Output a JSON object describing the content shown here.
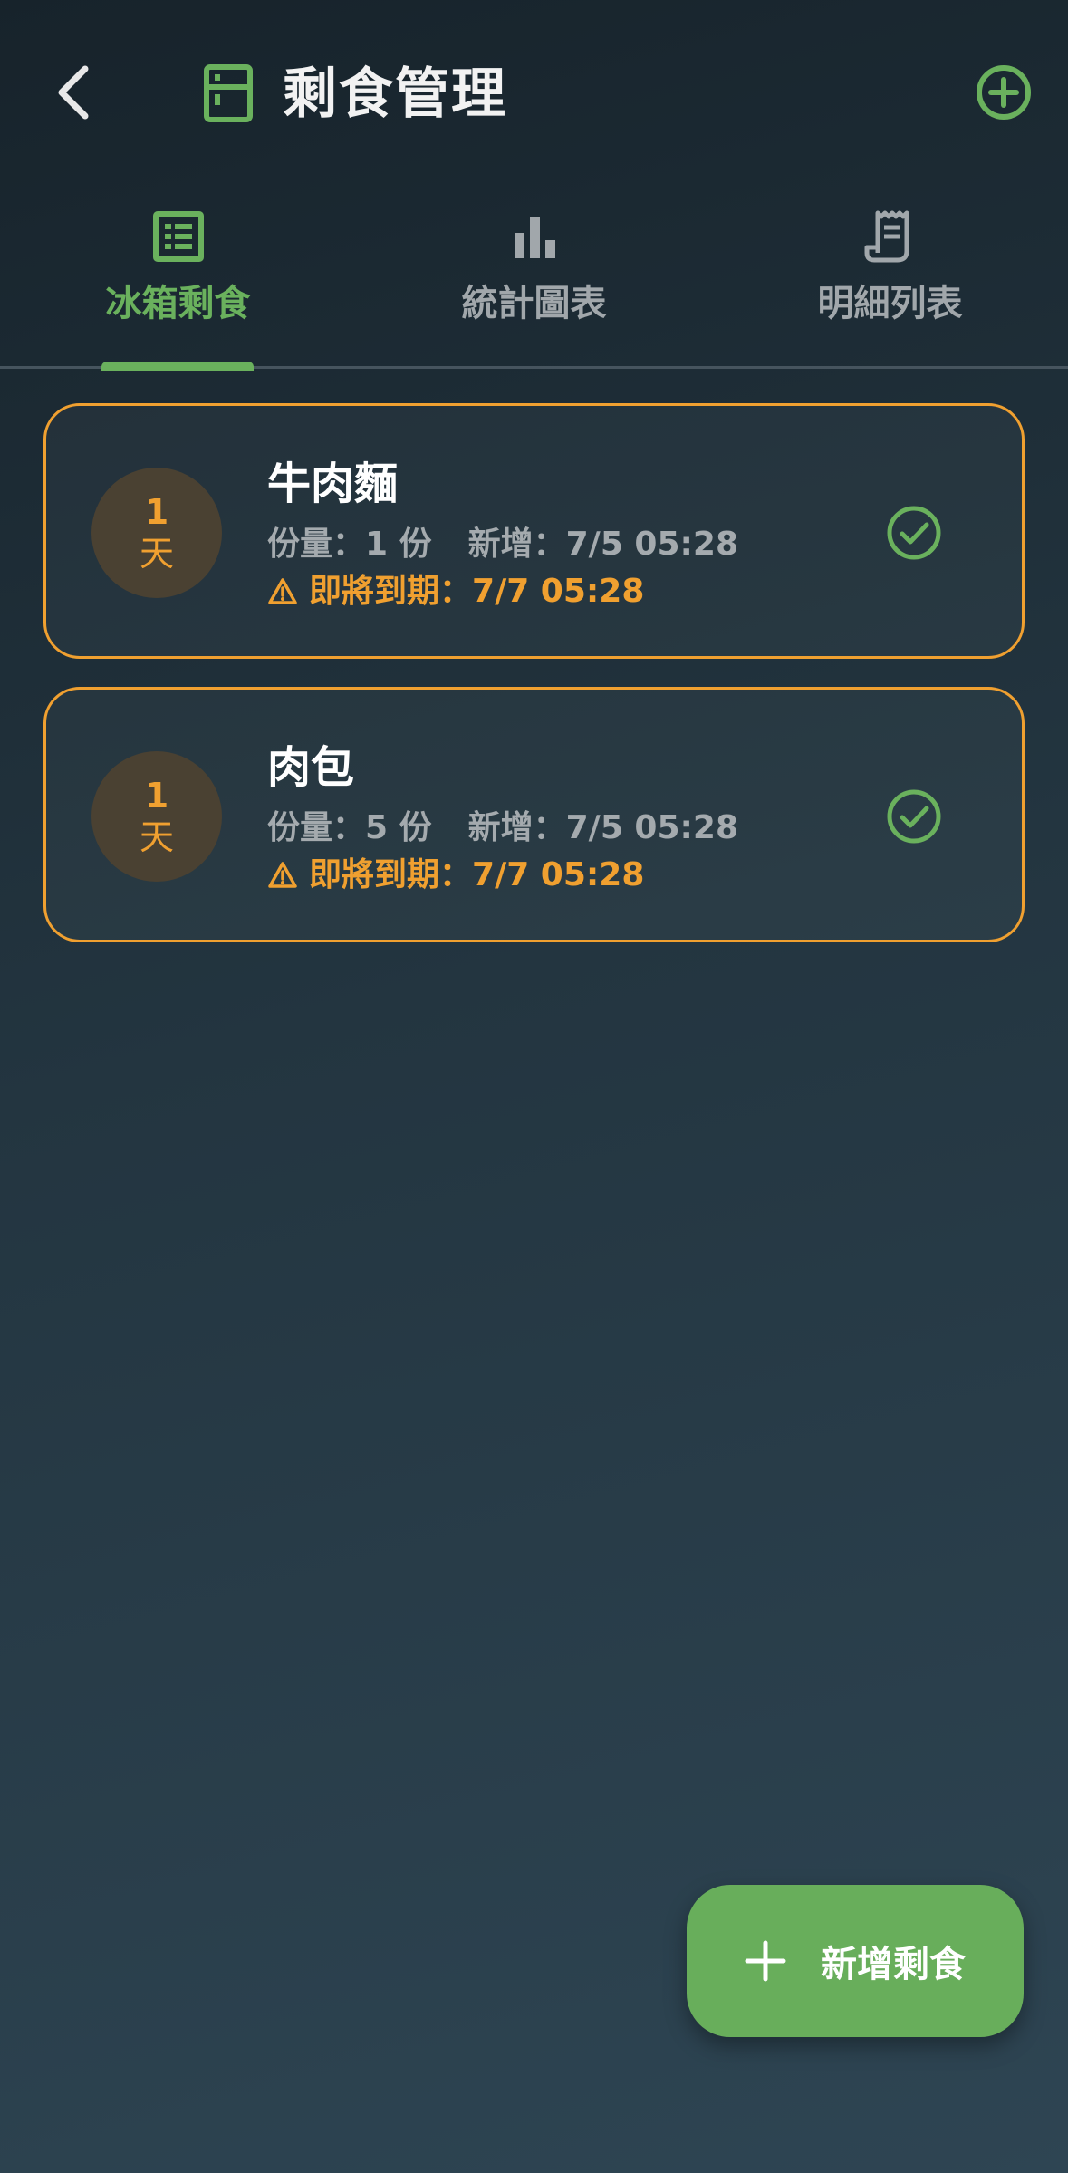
{
  "header": {
    "title": "剩食管理",
    "icons": {
      "back": "chevron-left-icon",
      "title": "fridge-icon",
      "add": "plus-circle-icon"
    }
  },
  "tabs": [
    {
      "label": "冰箱剩食",
      "icon": "list-icon",
      "active": true
    },
    {
      "label": "統計圖表",
      "icon": "bar-chart-icon",
      "active": false
    },
    {
      "label": "明細列表",
      "icon": "receipt-icon",
      "active": false
    }
  ],
  "items": [
    {
      "days_num": "1",
      "days_unit": "天",
      "name": "牛肉麵",
      "qty_label": "份量：",
      "qty": "1 份",
      "added_label": "新增：",
      "added": "7/5 05:28",
      "warning_label": "即將到期：",
      "expire": "7/7 05:28"
    },
    {
      "days_num": "1",
      "days_unit": "天",
      "name": "肉包",
      "qty_label": "份量：",
      "qty": "5 份",
      "added_label": "新增：",
      "added": "7/5 05:28",
      "warning_label": "即將到期：",
      "expire": "7/7 05:28"
    }
  ],
  "fab": {
    "label": "新增剩食",
    "icon": "plus-icon"
  },
  "colors": {
    "accent_green": "#6ab15d",
    "warning_orange": "#f0a030",
    "muted_text": "#a4aaae"
  }
}
